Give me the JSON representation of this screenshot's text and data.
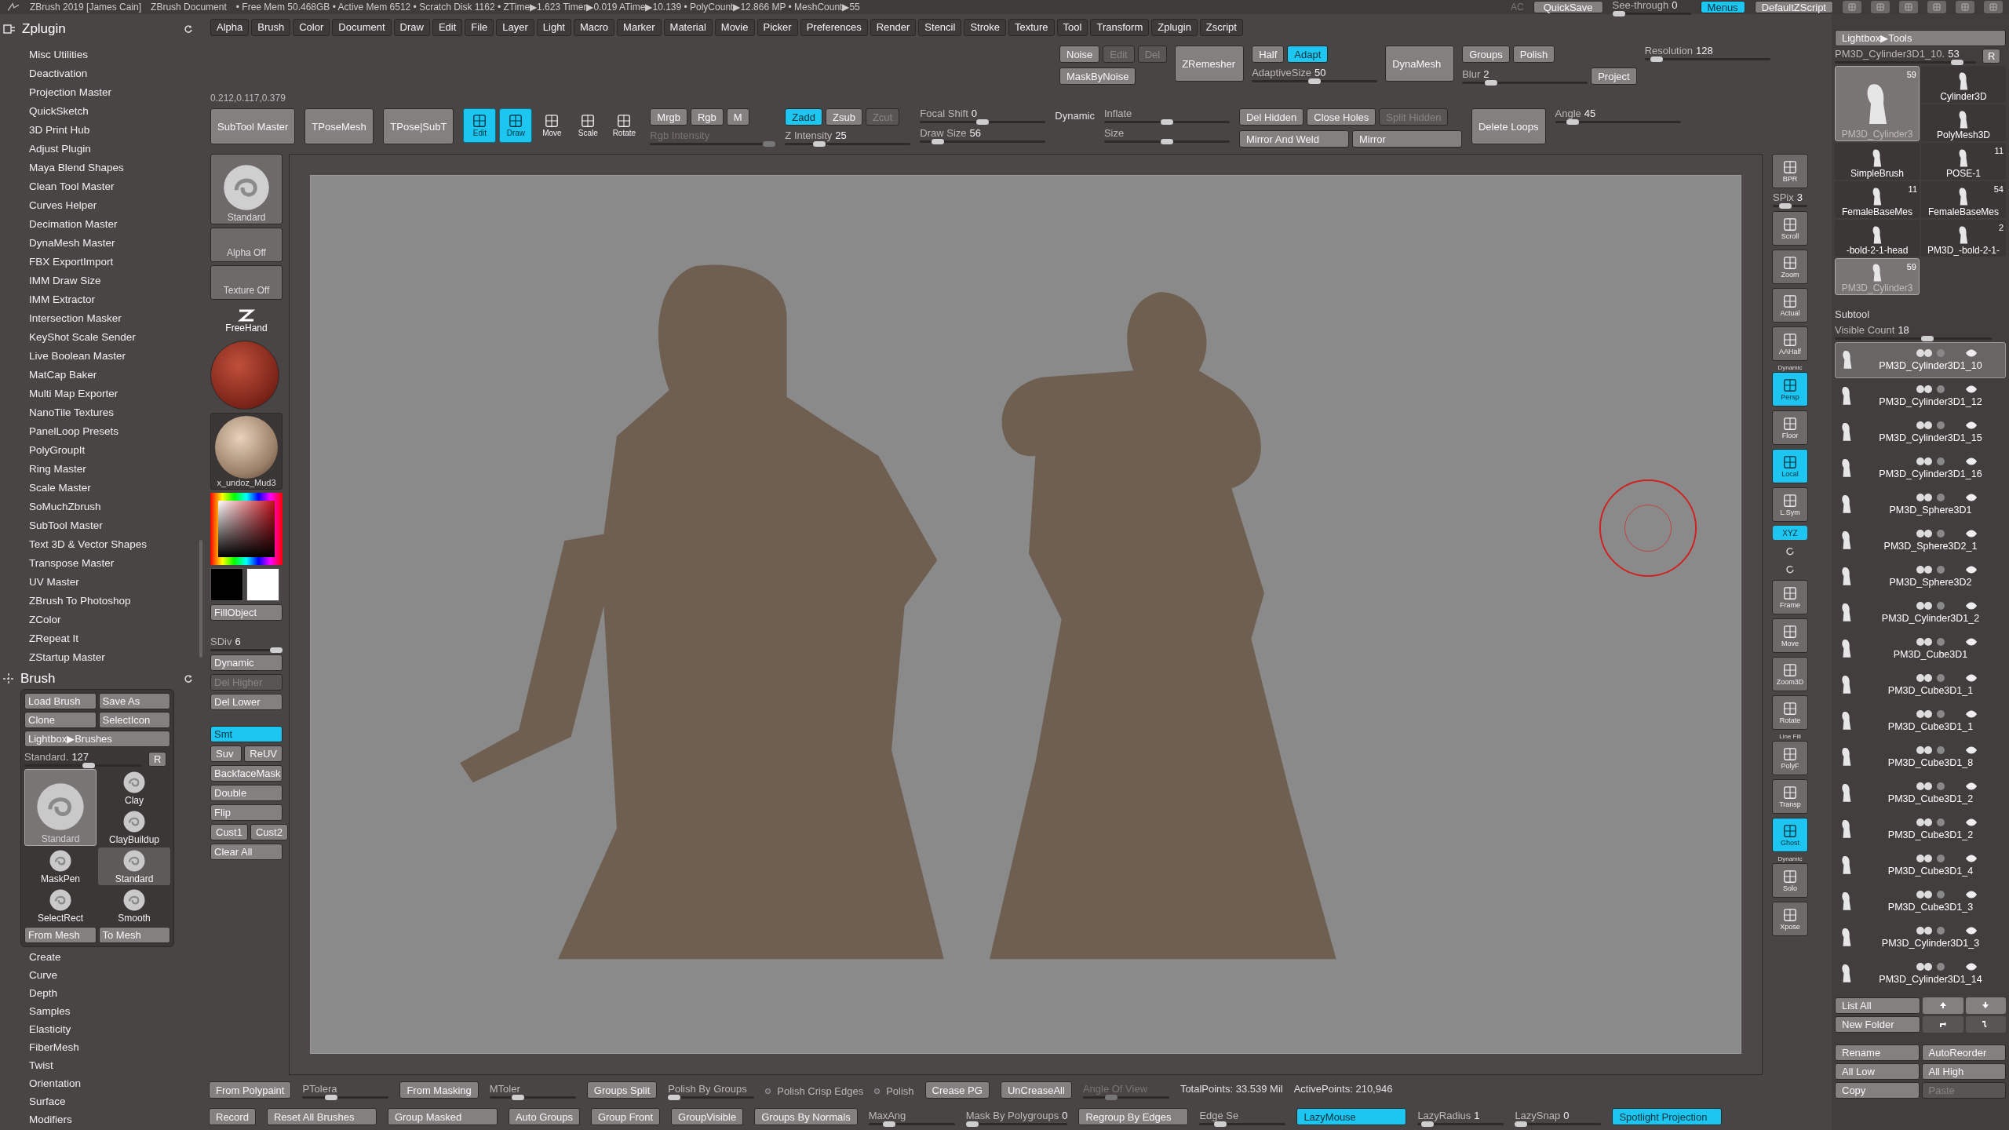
{
  "title_bar": {
    "app": "ZBrush 2019 [James Cain]",
    "document": "ZBrush Document",
    "stats": "• Free Mem 50.468GB • Active Mem 6512 • Scratch Disk 1162 • ZTime▶1.623 Timer▶0.019 ATime▶10.139 • PolyCount▶12.866 MP • MeshCount▶55",
    "ac": "AC",
    "quicksave": "QuickSave",
    "see_through": {
      "label": "See-through",
      "value": "0",
      "level": 0,
      "disabled": false
    },
    "buttons": [
      {
        "label": "Menus",
        "on": true
      },
      {
        "label": "DefaultZScript",
        "on": false
      }
    ]
  },
  "zplugin": {
    "title": "Zplugin",
    "items": [
      "Misc Utilities",
      "Deactivation",
      "Projection Master",
      "QuickSketch",
      "3D Print Hub",
      "Adjust Plugin",
      "Maya Blend Shapes",
      "Clean Tool Master",
      "Curves Helper",
      "Decimation Master",
      "DynaMesh Master",
      "FBX ExportImport",
      "IMM Draw Size",
      "IMM Extractor",
      "Intersection Masker",
      "KeyShot Scale Sender",
      "Live Boolean Master",
      "MatCap Baker",
      "Multi Map Exporter",
      "NanoTile Textures",
      "PanelLoop Presets",
      "PolyGroupIt",
      "Ring Master",
      "Scale Master",
      "SoMuchZbrush",
      "SubTool Master",
      "Text 3D & Vector Shapes",
      "Transpose Master",
      "UV Master",
      "ZBrush To Photoshop",
      "ZColor",
      "ZRepeat It",
      "ZStartup Master"
    ]
  },
  "brush_palette": {
    "title": "Brush",
    "buttons": [
      "Load Brush",
      "Save As",
      "Clone",
      "SelectIcon"
    ],
    "lightbox": "Lightbox▶Brushes",
    "slider": {
      "label": "Standard.",
      "value": "127",
      "level": 0.55,
      "disabled": false
    },
    "reset": "R",
    "brushes": [
      {
        "label": "Clay",
        "selected": false
      },
      {
        "label": "Standard",
        "selected": true
      },
      {
        "label": "ClayBuildup",
        "selected": false
      },
      {
        "label": "MaskPen",
        "selected": false
      },
      {
        "label": "Standard",
        "selected": false
      },
      {
        "label": "SelectRect",
        "selected": false
      },
      {
        "label": "Smooth",
        "selected": false
      }
    ],
    "mesh_buttons": [
      "From Mesh",
      "To Mesh"
    ],
    "submenus": [
      "Create",
      "Curve",
      "Depth",
      "Samples",
      "Elasticity",
      "FiberMesh",
      "Twist",
      "Orientation",
      "Surface",
      "Modifiers"
    ]
  },
  "menu_bar": [
    "Alpha",
    "Brush",
    "Color",
    "Document",
    "Draw",
    "Edit",
    "File",
    "Layer",
    "Light",
    "Macro",
    "Marker",
    "Material",
    "Movie",
    "Picker",
    "Preferences",
    "Render",
    "Stencil",
    "Stroke",
    "Texture",
    "Tool",
    "Transform",
    "Zplugin",
    "Zscript"
  ],
  "upper_toolbar": [
    [
      [
        {
          "kind": "button",
          "label": "Noise",
          "on": false,
          "disabled": false
        },
        {
          "kind": "button",
          "label": "Edit",
          "on": false,
          "disabled": true
        },
        {
          "kind": "button",
          "label": "Del",
          "on": false,
          "disabled": true
        }
      ],
      [
        {
          "kind": "button",
          "label": "MaskByNoise",
          "on": false,
          "disabled": false
        }
      ]
    ],
    [
      [
        {
          "kind": "big_button",
          "label": "ZRemesher",
          "on": false,
          "disabled": false
        }
      ]
    ],
    [
      [
        {
          "kind": "button",
          "label": "Half",
          "on": false,
          "disabled": false
        },
        {
          "kind": "button",
          "label": "Adapt",
          "on": true,
          "disabled": false
        }
      ],
      [
        {
          "kind": "slider",
          "label": "AdaptiveSize",
          "value": "50",
          "level": 0.5,
          "disabled": false
        }
      ]
    ],
    [
      [
        {
          "kind": "big_button",
          "label": "DynaMesh",
          "on": false,
          "disabled": false
        }
      ]
    ],
    [
      [
        {
          "kind": "button",
          "label": "Groups",
          "on": false,
          "disabled": false
        },
        {
          "kind": "button",
          "label": "Polish",
          "on": false,
          "disabled": false
        }
      ],
      [
        {
          "kind": "slider",
          "label": "Blur",
          "value": "2",
          "level": 0.2,
          "disabled": false
        },
        {
          "kind": "button",
          "label": "Project",
          "on": false,
          "disabled": false
        }
      ]
    ],
    [
      [
        {
          "kind": "slider",
          "label": "Resolution",
          "value": "128",
          "level": 0.05,
          "disabled": false
        }
      ]
    ]
  ],
  "color_readout": "0.212,0.117,0.379",
  "lower_toolbar": [
    [
      [
        {
          "kind": "big_button",
          "label": "SubTool Master",
          "on": false,
          "disabled": false
        }
      ]
    ],
    [
      [
        {
          "kind": "big_button",
          "label": "TPoseMesh",
          "on": false,
          "disabled": false
        }
      ]
    ],
    [
      [
        {
          "kind": "big_button",
          "label": "TPose|SubT",
          "on": false,
          "disabled": false
        }
      ]
    ],
    [
      [
        {
          "kind": "tool",
          "label": "Edit",
          "on": true
        },
        {
          "kind": "tool",
          "label": "Draw",
          "on": true
        },
        {
          "kind": "tool",
          "label": "Move",
          "on": false
        },
        {
          "kind": "tool",
          "label": "Scale",
          "on": false
        },
        {
          "kind": "tool",
          "label": "Rotate",
          "on": false
        }
      ]
    ],
    [
      [
        {
          "kind": "button",
          "label": "Mrgb",
          "on": false,
          "disabled": false
        },
        {
          "kind": "button",
          "label": "Rgb",
          "on": false,
          "disabled": false
        },
        {
          "kind": "button",
          "label": "M",
          "on": false,
          "disabled": false
        }
      ],
      [
        {
          "kind": "slider",
          "label": "Rgb Intensity",
          "level": 1,
          "disabled": true
        }
      ]
    ],
    [
      [
        {
          "kind": "button",
          "label": "Zadd",
          "on": true,
          "disabled": false
        },
        {
          "kind": "button",
          "label": "Zsub",
          "on": false,
          "disabled": false
        },
        {
          "kind": "button",
          "label": "Zcut",
          "on": false,
          "disabled": true
        }
      ],
      [
        {
          "kind": "slider",
          "label": "Z Intensity",
          "value": "25",
          "level": 0.25,
          "disabled": false
        }
      ]
    ],
    [
      [
        {
          "kind": "slider",
          "label": "Focal Shift",
          "value": "0",
          "level": 0.5,
          "disabled": false
        }
      ],
      [
        {
          "kind": "slider",
          "label": "Draw Size",
          "value": "56",
          "level": 0.1,
          "disabled": false
        }
      ]
    ],
    [
      [
        {
          "kind": "label",
          "label": "Dynamic"
        }
      ]
    ],
    [
      [
        {
          "kind": "slider",
          "label": "Inflate",
          "level": 0.5,
          "disabled": false
        }
      ],
      [
        {
          "kind": "slider",
          "label": "Size",
          "level": 0.5,
          "disabled": false
        }
      ]
    ],
    [
      [
        {
          "kind": "button",
          "label": "Del Hidden",
          "on": false,
          "disabled": false
        },
        {
          "kind": "button",
          "label": "Close Holes",
          "on": false,
          "disabled": false
        },
        {
          "kind": "button",
          "label": "Split Hidden",
          "on": false,
          "disabled": true
        }
      ],
      [
        {
          "kind": "wide_button",
          "label": "Mirror And Weld",
          "on": false,
          "disabled": false
        },
        {
          "kind": "wide_button",
          "label": "Mirror",
          "on": false,
          "disabled": false
        }
      ]
    ],
    [
      [
        {
          "kind": "big_button",
          "label": "Delete Loops",
          "on": false,
          "disabled": false
        }
      ]
    ],
    [
      [
        {
          "kind": "slider",
          "label": "Angle",
          "value": "45",
          "level": 0.1,
          "disabled": false
        }
      ]
    ]
  ],
  "left_shelf": [
    [
      {
        "kind": "brush_thumb",
        "label": "Standard"
      }
    ],
    [
      {
        "kind": "slot",
        "label": "Alpha Off"
      }
    ],
    [
      {
        "kind": "slot",
        "label": "Texture Off"
      }
    ],
    [
      {
        "kind": "stroke",
        "label": "FreeHand"
      }
    ],
    [
      {
        "kind": "material"
      }
    ],
    [
      {
        "kind": "material_thumb",
        "label": "x_undoz_Mud3"
      }
    ],
    [
      {
        "kind": "color_picker"
      }
    ],
    [
      {
        "kind": "swatches"
      }
    ],
    [
      {
        "kind": "button",
        "label": "FillObject",
        "on": false,
        "disabled": false
      }
    ],
    [
      {
        "kind": "spacer"
      }
    ],
    [
      {
        "kind": "slider",
        "label": "SDiv",
        "value": "6",
        "level": 1,
        "disabled": false
      }
    ],
    [
      {
        "kind": "button",
        "label": "Dynamic",
        "on": false,
        "disabled": false
      }
    ],
    [
      {
        "kind": "button",
        "label": "Del Higher",
        "on": false,
        "disabled": true
      }
    ],
    [
      {
        "kind": "button",
        "label": "Del Lower",
        "on": false,
        "disabled": false
      }
    ],
    [
      {
        "kind": "spacer"
      }
    ],
    [
      {
        "kind": "button",
        "label": "Smt",
        "on": true,
        "disabled": false
      }
    ],
    [
      {
        "kind": "button",
        "label": "Suv",
        "on": false,
        "disabled": false
      },
      {
        "kind": "button",
        "label": "ReUV",
        "on": false,
        "disabled": false
      }
    ],
    [
      {
        "kind": "button",
        "label": "BackfaceMask",
        "on": false,
        "disabled": false
      }
    ],
    [
      {
        "kind": "button",
        "label": "Double",
        "on": false,
        "disabled": false
      }
    ],
    [
      {
        "kind": "button",
        "label": "Flip",
        "on": false,
        "disabled": false
      }
    ],
    [
      {
        "kind": "button",
        "label": "Cust1",
        "on": false,
        "disabled": false
      },
      {
        "kind": "button",
        "label": "Cust2",
        "on": false,
        "disabled": false
      }
    ],
    [
      {
        "kind": "button",
        "label": "Clear All",
        "on": false,
        "disabled": false
      }
    ]
  ],
  "right_shelf": [
    {
      "kind": "icon",
      "label": "BPR",
      "on": false
    },
    {
      "kind": "slider",
      "label": "SPix",
      "value": "3",
      "level": 0.3,
      "disabled": false
    },
    {
      "kind": "icon",
      "label": "Scroll",
      "on": false
    },
    {
      "kind": "icon",
      "label": "Zoom",
      "on": false
    },
    {
      "kind": "icon",
      "label": "Actual",
      "on": false
    },
    {
      "kind": "icon",
      "label": "AAHalf",
      "on": false
    },
    {
      "kind": "icon",
      "label": "Persp",
      "caption": "Dynamic",
      "on": true
    },
    {
      "kind": "icon",
      "label": "Floor",
      "on": false
    },
    {
      "kind": "icon",
      "label": "Local",
      "on": true
    },
    {
      "kind": "icon",
      "label": "L.Sym",
      "on": false
    },
    {
      "kind": "small",
      "label": "XYZ",
      "on": true
    },
    {
      "kind": "mini",
      "on": false
    },
    {
      "kind": "mini",
      "on": false
    },
    {
      "kind": "icon",
      "label": "Frame",
      "on": false
    },
    {
      "kind": "icon",
      "label": "Move",
      "on": false
    },
    {
      "kind": "icon",
      "label": "Zoom3D",
      "on": false
    },
    {
      "kind": "icon",
      "label": "Rotate",
      "on": false
    },
    {
      "kind": "icon",
      "label": "PolyF",
      "caption": "Line Fill",
      "on": false
    },
    {
      "kind": "icon",
      "label": "Transp",
      "on": false
    },
    {
      "kind": "icon",
      "label": "Ghost",
      "on": true
    },
    {
      "kind": "icon",
      "label": "Solo",
      "caption": "Dynamic",
      "on": false
    },
    {
      "kind": "icon",
      "label": "Xpose",
      "on": false
    }
  ],
  "bottom_rows": [
    [
      {
        "kind": "button",
        "label": "From Polypaint",
        "on": false,
        "disabled": false
      },
      {
        "kind": "slider",
        "label": "PTolera",
        "level": 0.3,
        "disabled": false
      },
      {
        "kind": "button",
        "label": "From Masking",
        "on": false,
        "disabled": false
      },
      {
        "kind": "slider",
        "label": "MToler",
        "level": 0.3,
        "disabled": false
      },
      {
        "kind": "button",
        "label": "Groups Split",
        "on": false,
        "disabled": false
      },
      {
        "kind": "slider",
        "label": "Polish By Groups",
        "level": 0,
        "disabled": false
      },
      {
        "kind": "radio",
        "label": "Polish Crisp Edges",
        "checked": false
      },
      {
        "kind": "radio",
        "label": "Polish",
        "checked": false
      },
      {
        "kind": "button",
        "label": "Crease PG",
        "on": false,
        "disabled": false
      },
      {
        "kind": "button",
        "label": "UnCreaseAll",
        "on": false,
        "disabled": false
      },
      {
        "kind": "slider",
        "label": "Angle Of View",
        "level": 0.3,
        "disabled": true
      },
      {
        "kind": "label",
        "label": "TotalPoints: 33.539 Mil"
      },
      {
        "kind": "label",
        "label": "ActivePoints: 210,946"
      }
    ],
    [
      {
        "kind": "button",
        "label": "Record",
        "on": false,
        "disabled": false
      },
      {
        "kind": "wide_button",
        "label": "Reset All Brushes",
        "on": false,
        "disabled": false
      },
      {
        "kind": "wide_button",
        "label": "Group Masked",
        "on": false,
        "disabled": false
      },
      {
        "kind": "button",
        "label": "Auto Groups",
        "on": false,
        "disabled": false
      },
      {
        "kind": "button",
        "label": "Group Front",
        "on": false,
        "disabled": false
      },
      {
        "kind": "button",
        "label": "GroupVisible",
        "on": false,
        "disabled": false
      },
      {
        "kind": "button",
        "label": "Groups By Normals",
        "on": false,
        "disabled": false
      },
      {
        "kind": "slider",
        "label": "MaxAng",
        "level": 0.2,
        "disabled": false
      },
      {
        "kind": "slider",
        "label": "Mask By Polygroups",
        "value": "0",
        "level": 0,
        "disabled": false
      },
      {
        "kind": "wide_button",
        "label": "Regroup By Edges",
        "on": false,
        "disabled": false
      },
      {
        "kind": "slider",
        "label": "Edge Se",
        "level": 0.2,
        "disabled": false
      },
      {
        "kind": "wide_button",
        "label": "LazyMouse",
        "on": true,
        "disabled": false
      },
      {
        "kind": "slider",
        "label": "LazyRadius",
        "value": "1",
        "level": 0.05,
        "disabled": false
      },
      {
        "kind": "slider",
        "label": "LazySnap",
        "value": "0",
        "level": 0,
        "disabled": false
      },
      {
        "kind": "wide_button",
        "label": "Spotlight Projection",
        "on": true,
        "disabled": false
      }
    ]
  ],
  "tool_palette": {
    "lightbox": "Lightbox▶Tools",
    "slider": {
      "label": "PM3D_Cylinder3D1_10.",
      "value": "53",
      "level": 0.9,
      "disabled": false
    },
    "reset": "R",
    "tools": [
      {
        "label": "PM3D_Cylinder3",
        "count": "59",
        "selected": true
      },
      {
        "label": "Cylinder3D",
        "selected": false
      },
      {
        "label": "PolyMesh3D",
        "selected": false
      },
      {
        "label": "SimpleBrush",
        "selected": false
      },
      {
        "label": "POSE-1",
        "count": "11",
        "selected": false
      },
      {
        "label": "FemaleBaseMes",
        "count": "11",
        "selected": false
      },
      {
        "label": "FemaleBaseMes",
        "count": "54",
        "selected": false
      },
      {
        "label": "-bold-2-1-head",
        "selected": false
      },
      {
        "label": "PM3D_-bold-2-1-",
        "count": "2",
        "selected": false
      },
      {
        "label": "PM3D_Cylinder3",
        "count": "59",
        "selected": true
      }
    ]
  },
  "subtool": {
    "title": "Subtool",
    "visible_count": {
      "label": "Visible Count",
      "value": "18",
      "level": 0.6,
      "disabled": false
    },
    "items": [
      {
        "name": "PM3D_Cylinder3D1_10",
        "selected": true
      },
      {
        "name": "PM3D_Cylinder3D1_12",
        "selected": false
      },
      {
        "name": "PM3D_Cylinder3D1_15",
        "selected": false
      },
      {
        "name": "PM3D_Cylinder3D1_16",
        "selected": false
      },
      {
        "name": "PM3D_Sphere3D1",
        "selected": false
      },
      {
        "name": "PM3D_Sphere3D2_1",
        "selected": false
      },
      {
        "name": "PM3D_Sphere3D2",
        "selected": false
      },
      {
        "name": "PM3D_Cylinder3D1_2",
        "selected": false
      },
      {
        "name": "PM3D_Cube3D1",
        "selected": false
      },
      {
        "name": "PM3D_Cube3D1_1",
        "selected": false
      },
      {
        "name": "PM3D_Cube3D1_1",
        "selected": false
      },
      {
        "name": "PM3D_Cube3D1_8",
        "selected": false
      },
      {
        "name": "PM3D_Cube3D1_2",
        "selected": false
      },
      {
        "name": "PM3D_Cube3D1_2",
        "selected": false
      },
      {
        "name": "PM3D_Cube3D1_4",
        "selected": false
      },
      {
        "name": "PM3D_Cube3D1_3",
        "selected": false
      },
      {
        "name": "PM3D_Cylinder3D1_3",
        "selected": false
      },
      {
        "name": "PM3D_Cylinder3D1_14",
        "selected": false
      }
    ],
    "list_all": "List All",
    "new_folder": "New Folder",
    "buttons": [
      {
        "label": "Rename",
        "disabled": false
      },
      {
        "label": "AutoReorder",
        "disabled": false
      },
      {
        "label": "All Low",
        "disabled": false
      },
      {
        "label": "All High",
        "disabled": false
      },
      {
        "label": "Copy",
        "disabled": false
      },
      {
        "label": "Paste",
        "disabled": true
      }
    ]
  }
}
